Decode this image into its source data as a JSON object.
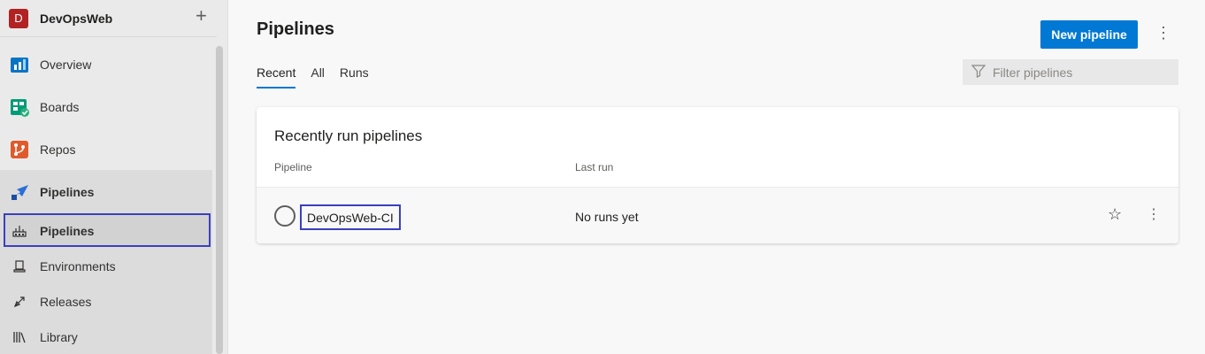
{
  "project": {
    "avatar": "D",
    "name": "DevOpsWeb",
    "add_icon": "+"
  },
  "sidebar": {
    "items": [
      {
        "label": "Overview",
        "icon": "overview-icon"
      },
      {
        "label": "Boards",
        "icon": "boards-icon"
      },
      {
        "label": "Repos",
        "icon": "repos-icon"
      },
      {
        "label": "Pipelines",
        "icon": "pipelines-icon"
      },
      {
        "label": "Pipelines",
        "icon": "pipelines-sub-icon"
      },
      {
        "label": "Environments",
        "icon": "environments-icon"
      },
      {
        "label": "Releases",
        "icon": "releases-icon"
      },
      {
        "label": "Library",
        "icon": "library-icon"
      }
    ]
  },
  "header": {
    "title": "Pipelines",
    "new_button": "New pipeline",
    "more_icon": "⋮"
  },
  "tabs": [
    {
      "label": "Recent"
    },
    {
      "label": "All"
    },
    {
      "label": "Runs"
    }
  ],
  "filter": {
    "placeholder": "Filter pipelines"
  },
  "card": {
    "title": "Recently run pipelines",
    "columns": {
      "pipeline": "Pipeline",
      "last_run": "Last run"
    },
    "rows": [
      {
        "name": "DevOpsWeb-CI",
        "last_run": "No runs yet",
        "star_icon": "☆",
        "more_icon": "⋮"
      }
    ]
  },
  "colors": {
    "accent": "#0078d4",
    "project_avatar": "#b22222",
    "highlight": "#3b3fbf"
  }
}
